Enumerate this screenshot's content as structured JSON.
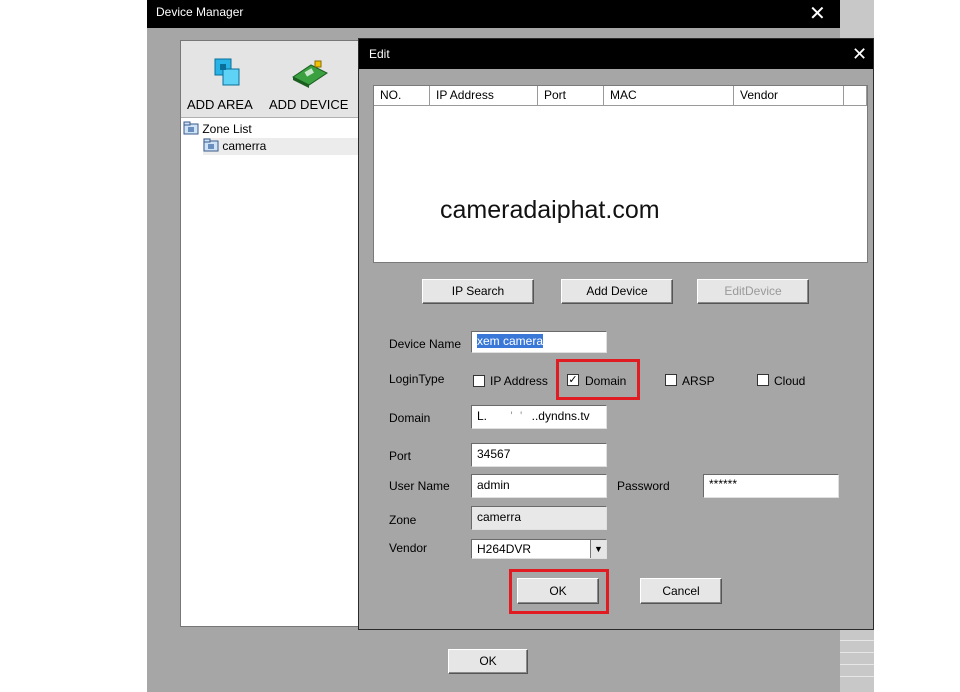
{
  "device_manager": {
    "title": "Device Manager",
    "close_glyph": "✕",
    "toolbar": {
      "add_area_label": "ADD AREA",
      "add_device_label": "ADD DEVICE"
    },
    "tree": {
      "root_label": "Zone List",
      "child_label": "camerra"
    },
    "ok_label": "OK"
  },
  "edit_dialog": {
    "title": "Edit",
    "close_glyph": "✕",
    "table": {
      "columns": [
        "NO.",
        "IP Address",
        "Port",
        "MAC",
        "Vendor",
        ""
      ],
      "rows": []
    },
    "watermark": "cameradaiphat.com",
    "buttons": {
      "ip_search": "IP Search",
      "add_device": "Add Device",
      "edit_device": "EditDevice"
    },
    "form": {
      "device_name_label": "Device Name",
      "device_name_value": "xem camera",
      "login_type_label": "LoginType",
      "login_options": [
        {
          "label": "IP Address",
          "checked": false
        },
        {
          "label": "Domain",
          "checked": true
        },
        {
          "label": "ARSP",
          "checked": false
        },
        {
          "label": "Cloud",
          "checked": false
        }
      ],
      "domain_label": "Domain",
      "domain_value_start": "L.",
      "domain_value_end": "..dyndns.tv",
      "port_label": "Port",
      "port_value": "34567",
      "username_label": "User Name",
      "username_value": "admin",
      "password_label": "Password",
      "password_value": "******",
      "zone_label": "Zone",
      "zone_value": "camerra",
      "vendor_label": "Vendor",
      "vendor_value": "H264DVR"
    },
    "ok_label": "OK",
    "cancel_label": "Cancel",
    "highlight_color": "#e11b22"
  }
}
